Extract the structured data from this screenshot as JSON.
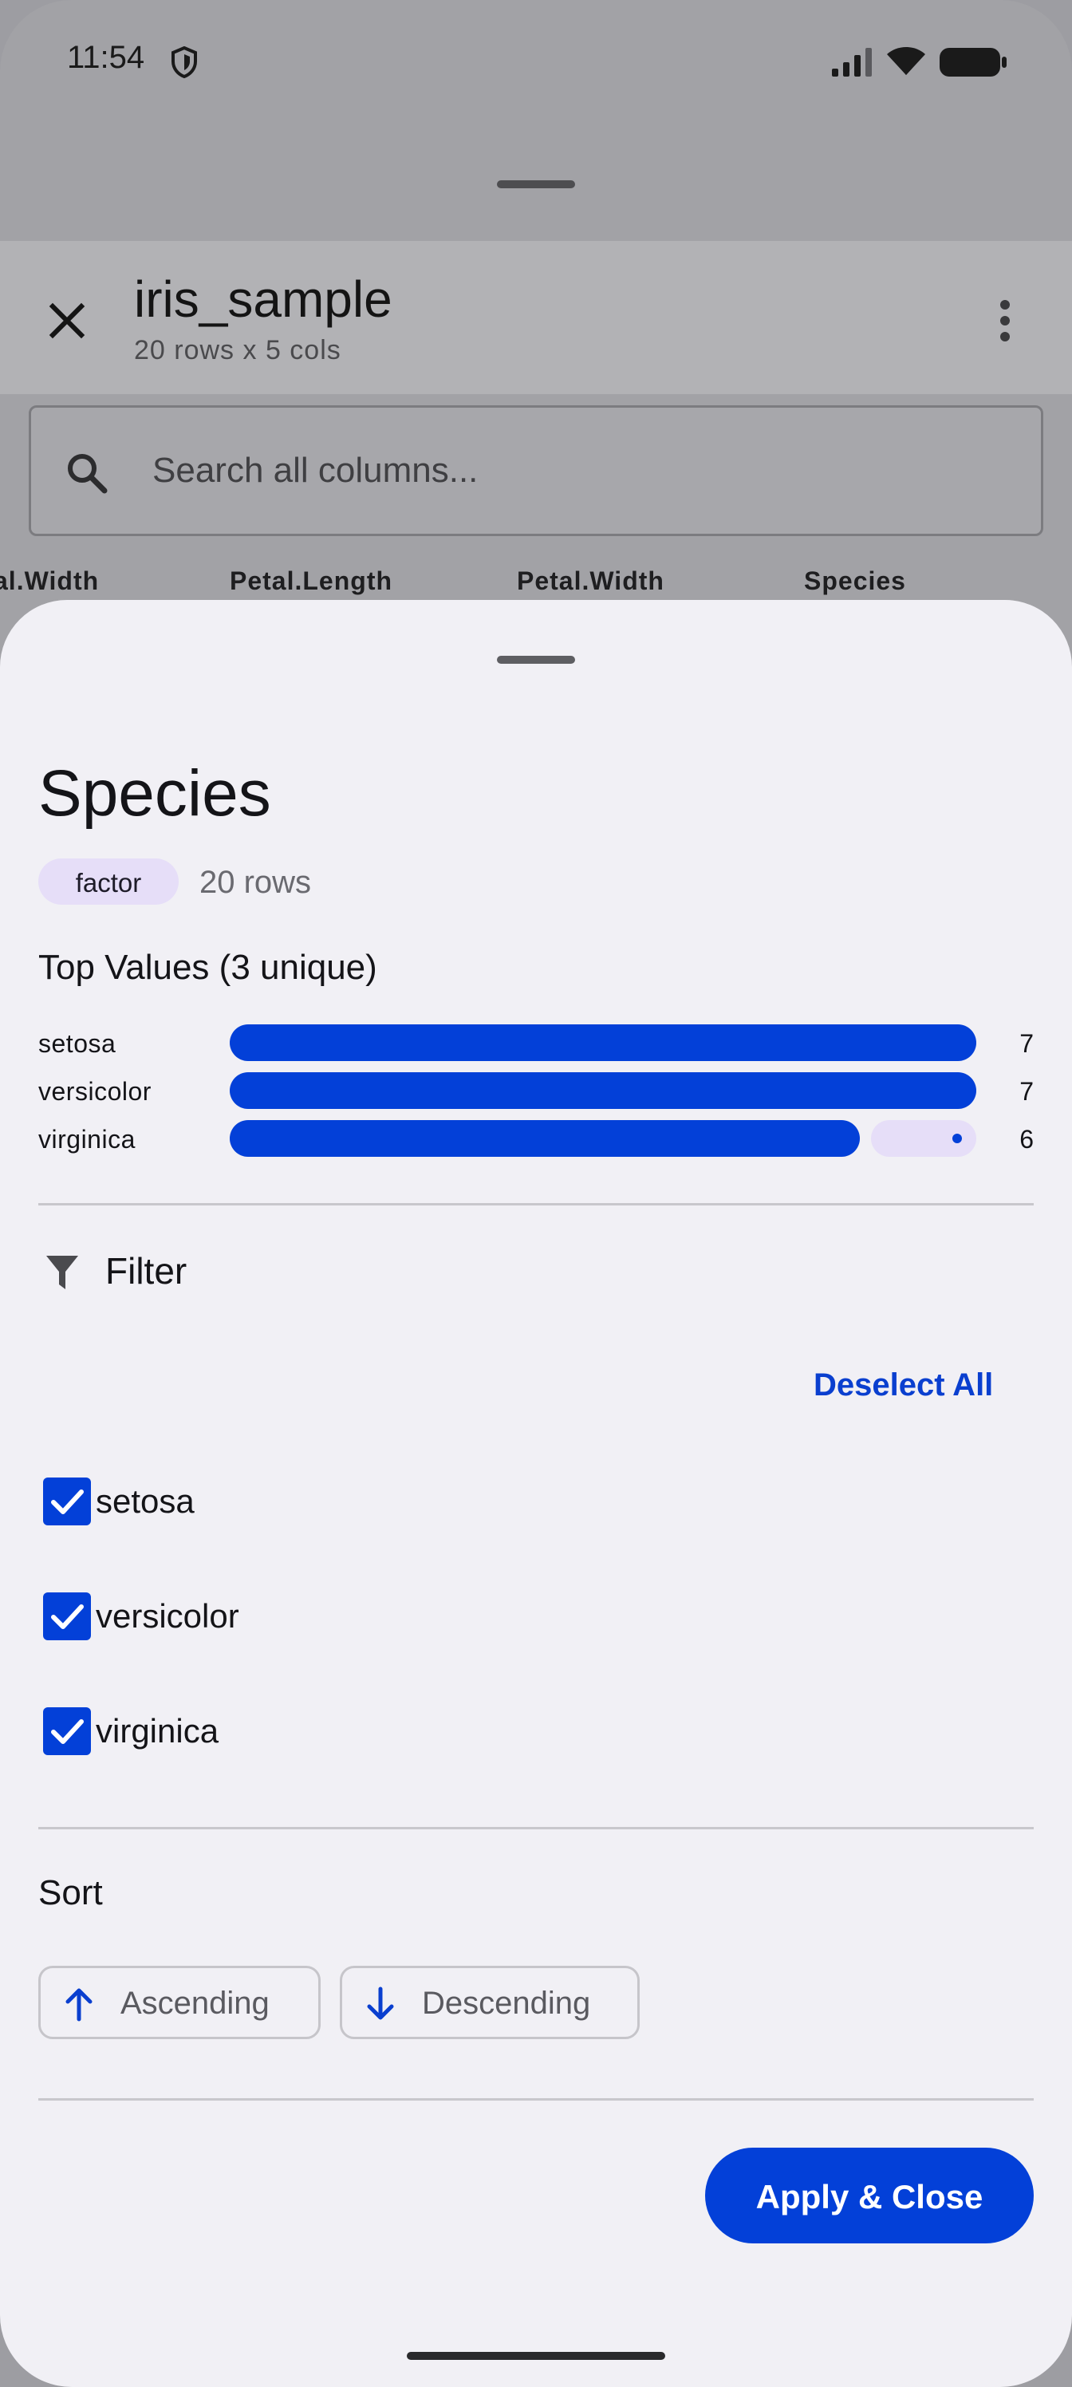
{
  "status_bar": {
    "time": "11:54"
  },
  "app_bar": {
    "title": "iris_sample",
    "subtitle": "20 rows x 5 cols"
  },
  "search": {
    "placeholder": "Search all columns..."
  },
  "table_columns": [
    "al.Width",
    "Petal.Length",
    "Petal.Width",
    "Species"
  ],
  "sheet": {
    "title": "Species",
    "type_chip": "factor",
    "rows_count": "20 rows",
    "top_values_title": "Top Values (3 unique)",
    "top_values": [
      {
        "label": "setosa",
        "count": "7",
        "fraction": 1.0
      },
      {
        "label": "versicolor",
        "count": "7",
        "fraction": 1.0
      },
      {
        "label": "virginica",
        "count": "6",
        "fraction": 0.857
      }
    ],
    "filter": {
      "title": "Filter",
      "deselect_all": "Deselect All",
      "options": [
        {
          "label": "setosa",
          "checked": true
        },
        {
          "label": "versicolor",
          "checked": true
        },
        {
          "label": "virginica",
          "checked": true
        }
      ]
    },
    "sort": {
      "title": "Sort",
      "ascending": "Ascending",
      "descending": "Descending"
    },
    "apply_button": "Apply & Close"
  },
  "colors": {
    "accent": "#0340d8",
    "chip_bg": "#e6def8",
    "sheet_bg": "#f1f0f5"
  },
  "icons": [
    "shield-icon",
    "signal-icon",
    "wifi-icon",
    "battery-icon",
    "close-icon",
    "more-vert-icon",
    "search-icon",
    "filter-icon",
    "check-icon",
    "arrow-up-icon",
    "arrow-down-icon"
  ]
}
